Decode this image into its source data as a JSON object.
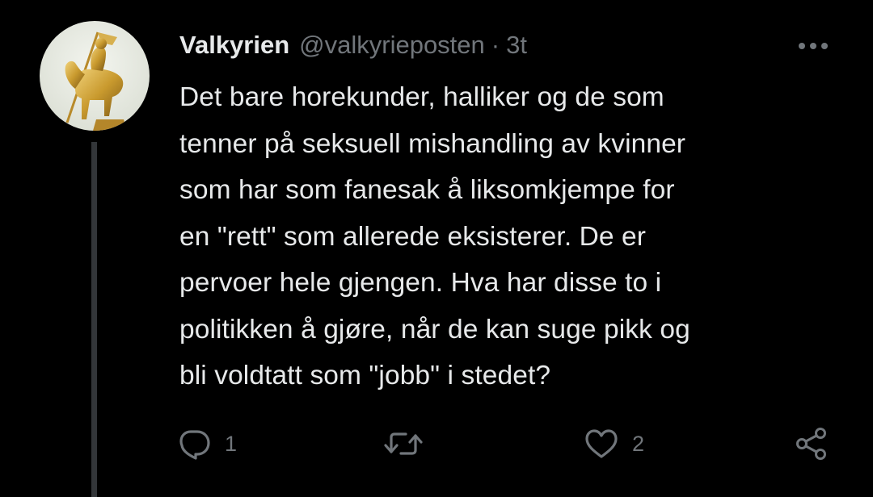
{
  "colors": {
    "background": "#000000",
    "primary_text": "#e7e9ea",
    "secondary_text": "#71767b",
    "thread_line": "#333639"
  },
  "tweet": {
    "avatar_icon": "golden-equestrian-statue-avatar",
    "display_name": "Valkyrien",
    "handle": "@valkyrieposten",
    "separator": "·",
    "timestamp": "3t",
    "more_icon": "more-horizontal-icon",
    "text": "Det bare horekunder, halliker og de som\ntenner på seksuell mishandling av kvinner\nsom har som fanesak å liksomkjempe for\nen \"rett\" som allerede eksisterer. De er\npervoer hele gjengen. Hva har disse to i\npolitikken å gjøre, når de kan suge pikk og\nbli voldtatt som \"jobb\" i stedet?",
    "actions": {
      "reply": {
        "icon": "reply-icon",
        "count": "1"
      },
      "retweet": {
        "icon": "retweet-icon",
        "count": ""
      },
      "like": {
        "icon": "heart-icon",
        "count": "2"
      },
      "share": {
        "icon": "share-icon"
      }
    }
  }
}
